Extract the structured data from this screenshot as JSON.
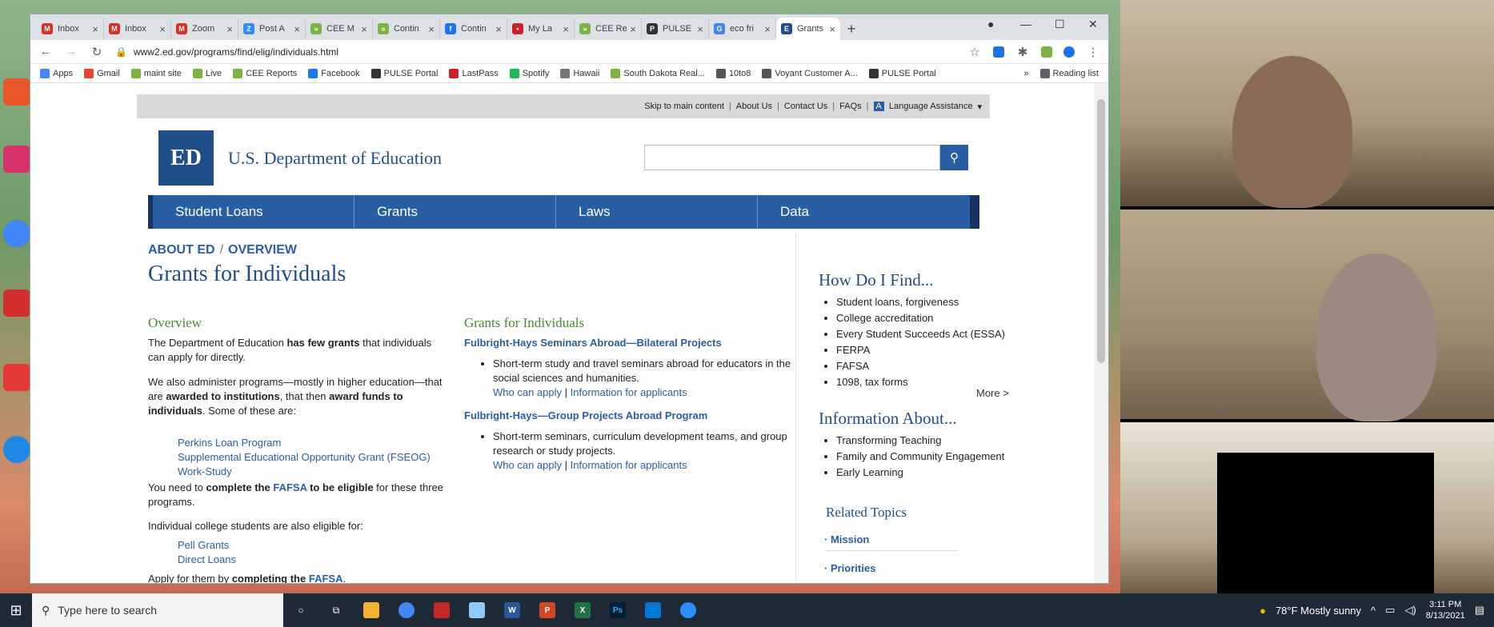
{
  "browser": {
    "tabs": [
      {
        "label": "Inbox",
        "fav": "M",
        "color": "#d93025"
      },
      {
        "label": "Inbox",
        "fav": "M",
        "color": "#d93025"
      },
      {
        "label": "Zoom",
        "fav": "M",
        "color": "#d93025"
      },
      {
        "label": "Post A",
        "fav": "Z",
        "color": "#2d8cff"
      },
      {
        "label": "CEE M",
        "fav": "»",
        "color": "#7cb342"
      },
      {
        "label": "Contin",
        "fav": "»",
        "color": "#7cb342"
      },
      {
        "label": "Contin",
        "fav": "f",
        "color": "#1877f2"
      },
      {
        "label": "My La",
        "fav": "•",
        "color": "#cc2127"
      },
      {
        "label": "CEE Re",
        "fav": "»",
        "color": "#7cb342"
      },
      {
        "label": "PULSE",
        "fav": "P",
        "color": "#333333"
      },
      {
        "label": "eco fri",
        "fav": "G",
        "color": "#4285f4"
      },
      {
        "label": "Grants",
        "fav": "E",
        "color": "#1f4e89"
      }
    ],
    "url": "www2.ed.gov/programs/find/elig/individuals.html",
    "bookmarks": [
      {
        "label": "Apps",
        "color": "#4285f4"
      },
      {
        "label": "Gmail",
        "color": "#ea4335"
      },
      {
        "label": "maint site",
        "color": "#7cb342"
      },
      {
        "label": "Live",
        "color": "#7cb342"
      },
      {
        "label": "CEE Reports",
        "color": "#7cb342"
      },
      {
        "label": "Facebook",
        "color": "#1877f2"
      },
      {
        "label": "PULSE Portal",
        "color": "#333333"
      },
      {
        "label": "LastPass",
        "color": "#cc2127"
      },
      {
        "label": "Spotify",
        "color": "#1db954"
      },
      {
        "label": "Hawaii",
        "color": "#777777"
      },
      {
        "label": "South Dakota Real...",
        "color": "#7cb342"
      },
      {
        "label": "10to8",
        "color": "#555555"
      },
      {
        "label": "Voyant Customer A...",
        "color": "#555555"
      },
      {
        "label": "PULSE Portal",
        "color": "#333333"
      }
    ],
    "reading_list": "Reading list",
    "overflow": "»"
  },
  "site": {
    "utility": [
      "Skip to main content",
      "About Us",
      "Contact Us",
      "FAQs",
      "Language Assistance"
    ],
    "dept_name": "U.S. Department of Education",
    "logo_text": "ED",
    "nav": [
      "Student Loans",
      "Grants",
      "Laws",
      "Data"
    ],
    "breadcrumb": {
      "a": "ABOUT ED",
      "sep": "/",
      "b": "OVERVIEW"
    },
    "title": "Grants for Individuals"
  },
  "overview": {
    "heading": "Overview",
    "p1a": "The Department of Education ",
    "p1b": "has few grants",
    "p1c": " that individuals can apply for directly.",
    "p2a": "We also administer programs—mostly in higher education—that are ",
    "p2b": "awarded to institutions",
    "p2c": ", that then ",
    "p2d": "award funds to individuals",
    "p2e": ". Some of these are:",
    "programs": [
      "Perkins Loan Program",
      "Supplemental Educational Opportunity Grant (FSEOG)",
      "Work-Study"
    ],
    "p3a": "You need to ",
    "p3b": "complete the ",
    "p3c": "FAFSA",
    "p3d": " to be eligible",
    "p3e": " for these three programs.",
    "p4": "Individual college students are also eligible for:",
    "eligible": [
      "Pell Grants",
      "Direct Loans"
    ],
    "p5a": "Apply for them by ",
    "p5b": "completing the ",
    "p5c": "FAFSA",
    "p5d": "."
  },
  "grants": {
    "heading": "Grants for Individuals",
    "g1_title": "Fulbright-Hays Seminars Abroad—Bilateral Projects",
    "g1_desc": "Short-term study and travel seminars abroad for educators in the social sciences and humanities.",
    "g2_title": "Fulbright-Hays—Group Projects Abroad Program",
    "g2_desc": "Short-term seminars, curriculum development teams, and group research or study projects.",
    "who": "Who can apply",
    "pipe": "|",
    "info": "Information for applicants"
  },
  "sidebar": {
    "find_heading": "How Do I Find...",
    "find_items": [
      "Student loans, forgiveness",
      "College accreditation",
      "Every Student Succeeds Act (ESSA)",
      "FERPA",
      "FAFSA",
      "1098, tax forms"
    ],
    "more": "More >",
    "about_heading": "Information About...",
    "about_items": [
      "Transforming Teaching",
      "Family and Community Engagement",
      "Early Learning"
    ],
    "related_heading": "Related Topics",
    "related_items": [
      "Mission",
      "Priorities"
    ]
  },
  "taskbar": {
    "search_placeholder": "Type here to search",
    "weather": "78°F  Mostly sunny",
    "time": "3:11 PM",
    "date": "8/13/2021"
  }
}
